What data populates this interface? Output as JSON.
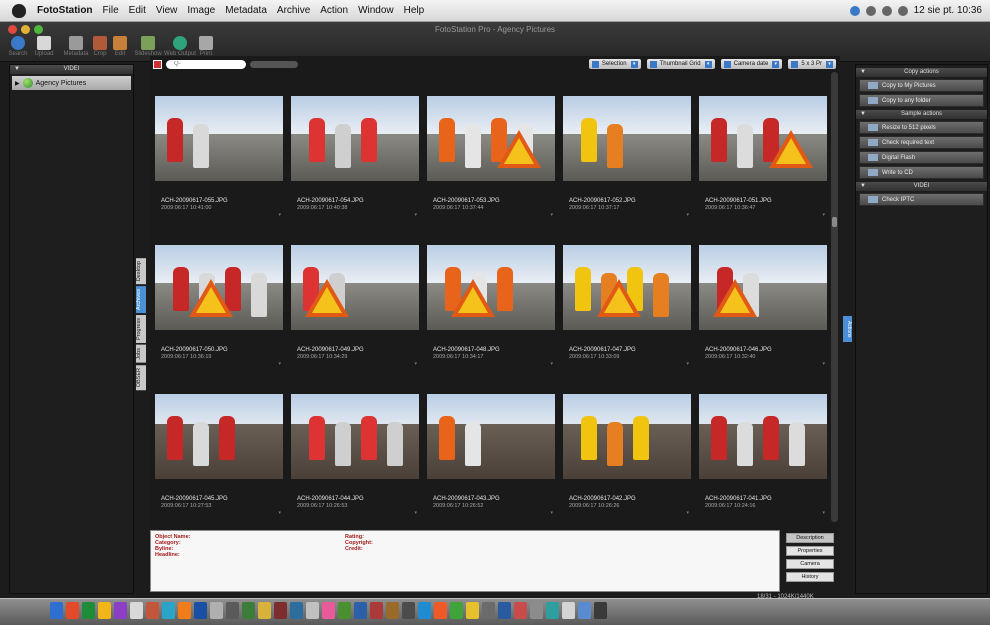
{
  "menubar": {
    "app_name": "FotoStation",
    "items": [
      "File",
      "Edit",
      "View",
      "Image",
      "Metadata",
      "Archive",
      "Action",
      "Window",
      "Help"
    ],
    "clock": "12 sie pt.  10:36"
  },
  "window": {
    "title": "FotoStation Pro - Agency Pictures"
  },
  "toolbar": {
    "buttons": [
      "Search",
      "Upload",
      "Metadata",
      "Crop",
      "Edit",
      "Slideshow",
      "Web Output",
      "Print"
    ]
  },
  "left_panel": {
    "header": "VIDEI",
    "archive": "Agency Pictures"
  },
  "side_tabs": [
    "Desktop",
    "Archives",
    "Progress",
    "Jobs",
    "OBSER"
  ],
  "search": {
    "placeholder": "Q-"
  },
  "view_controls": {
    "selection": "Selection",
    "view_mode": "Thumbnail Grid",
    "sort": "Camera date",
    "layout": "5 x 3 Pr"
  },
  "thumbnails": [
    {
      "file": "ACH-20090617-055.JPG",
      "date": "2009:06:17 10:41:00"
    },
    {
      "file": "ACH-20090617-054.JPG",
      "date": "2009:06:17 10:40:38"
    },
    {
      "file": "ACH-20090617-053.JPG",
      "date": "2009:06:17 10:37:44"
    },
    {
      "file": "ACH-20090617-052.JPG",
      "date": "2009:06:17 10:37:17"
    },
    {
      "file": "ACH-20090617-051.JPG",
      "date": "2009:06:17 10:36:47"
    },
    {
      "file": "ACH-20090617-050.JPG",
      "date": "2009:06:17 10:36:19"
    },
    {
      "file": "ACH-20090617-049.JPG",
      "date": "2009:06:17 10:34:29"
    },
    {
      "file": "ACH-20090617-048.JPG",
      "date": "2009:06:17 10:34:17"
    },
    {
      "file": "ACH-20090617-047.JPG",
      "date": "2009:06:17 10:33:09"
    },
    {
      "file": "ACH-20090617-046.JPG",
      "date": "2009:06:17 10:32:40"
    },
    {
      "file": "ACH-20090617-045.JPG",
      "date": "2009:06:17 10:27:53"
    },
    {
      "file": "ACH-20090617-044.JPG",
      "date": "2009:06:17 10:26:53"
    },
    {
      "file": "ACH-20090617-043.JPG",
      "date": "2009:06:17 10:26:52"
    },
    {
      "file": "ACH-20090617-042.JPG",
      "date": "2009:06:17 10:26:26"
    },
    {
      "file": "ACH-20090617-041.JPG",
      "date": "2009:06:17 10:24:16"
    }
  ],
  "details": {
    "object_name": "Object Name:",
    "category": "Category:",
    "byline": "Byline:",
    "headline": "Headline:",
    "rating": "Rating:",
    "copyright": "Copyright:",
    "credit": "Credit:"
  },
  "detail_tabs": [
    "Description",
    "Properties",
    "Camera",
    "History"
  ],
  "right_panel": {
    "sections": [
      {
        "title": "Copy actions",
        "items": [
          "Copy to My Pictures",
          "Copy to any folder"
        ]
      },
      {
        "title": "Sample actions",
        "items": [
          "Resize to 512 pixels",
          "Check required text",
          "Digital Flash",
          "Write to CD"
        ]
      },
      {
        "title": "VIDEI",
        "items": [
          "Check IPTC"
        ]
      }
    ]
  },
  "side_tab_right": "Actions",
  "counter": "18/31 - 1024K/1440K"
}
